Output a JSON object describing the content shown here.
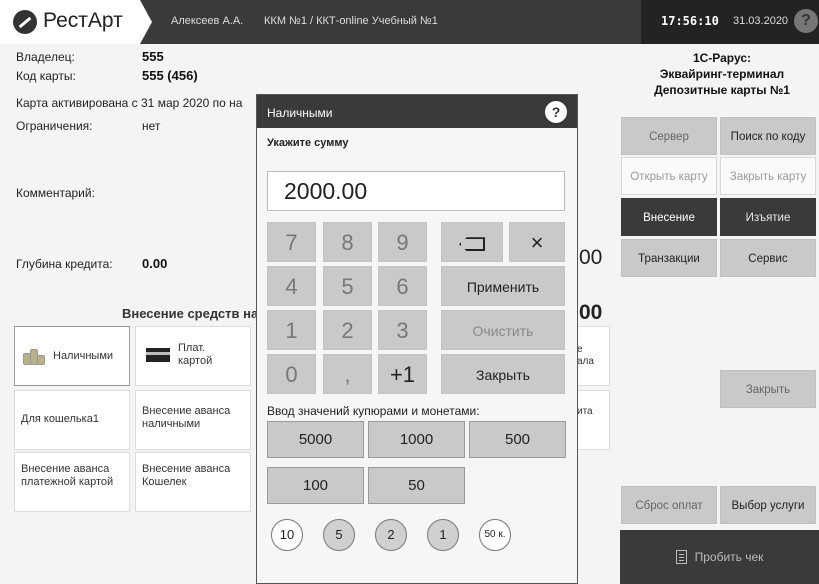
{
  "app": {
    "logo": "РестАрт",
    "user": "Алексеев А.А.",
    "kkm": "ККМ №1 / ККТ-online Учебный №1",
    "time": "17:56:10",
    "date": "31.03.2020",
    "help": "?"
  },
  "card": {
    "owner_label": "Владелец:",
    "owner_value": "555",
    "code_label": "Код карты:",
    "code_value": "555 (456)",
    "activated": "Карта активирована с 31 мар 2020 по на",
    "limits_label": "Ограничения:",
    "limits_value": "нет",
    "comment_label": "Комментарий:",
    "credit_label": "Глубина кредита:",
    "credit_value": "0.00",
    "partial_amount_1": "00",
    "partial_amount_2": "00"
  },
  "deposit": {
    "title": "Внесение средств на",
    "tiles": [
      {
        "label": "Наличными"
      },
      {
        "label": "Плат.\nкартой"
      },
      {
        "label": "Для кошелька1"
      },
      {
        "label": "Внесение аванса\nналичными"
      },
      {
        "label": "Внесение аванса\nплатежной картой"
      },
      {
        "label": "Внесение аванса\nКошелек"
      }
    ],
    "partial_1": "е",
    "partial_2": "ала",
    "partial_3": "ита"
  },
  "right": {
    "title_lines": [
      "1С-Рарус:",
      "Эквайринг-терминал",
      "Депозитные карты №1"
    ],
    "server": "Сервер",
    "search_code": "Поиск по коду",
    "open_card": "Открыть карту",
    "close_card": "Закрыть карту",
    "deposit": "Внесение",
    "withdraw": "Изъятие",
    "transactions": "Транзакции",
    "service": "Сервис",
    "close": "Закрыть",
    "reset": "Сброс оплат",
    "choose_service": "Выбор услуги",
    "print": "Пробить чек"
  },
  "modal": {
    "title": "Наличными",
    "help": "?",
    "prompt": "Укажите сумму",
    "amount": "2000.00",
    "keys": [
      "7",
      "8",
      "9",
      "4",
      "5",
      "6",
      "1",
      "2",
      "3",
      "0",
      ",",
      "+1"
    ],
    "clear_x": "×",
    "apply": "Применить",
    "reset": "Очистить",
    "close": "Закрыть",
    "denom_title": "Ввод значений купюрами и монетами:",
    "notes": [
      "5000",
      "1000",
      "500",
      "100",
      "50"
    ],
    "coins": [
      "10",
      "5",
      "2",
      "1",
      "50 к."
    ]
  }
}
